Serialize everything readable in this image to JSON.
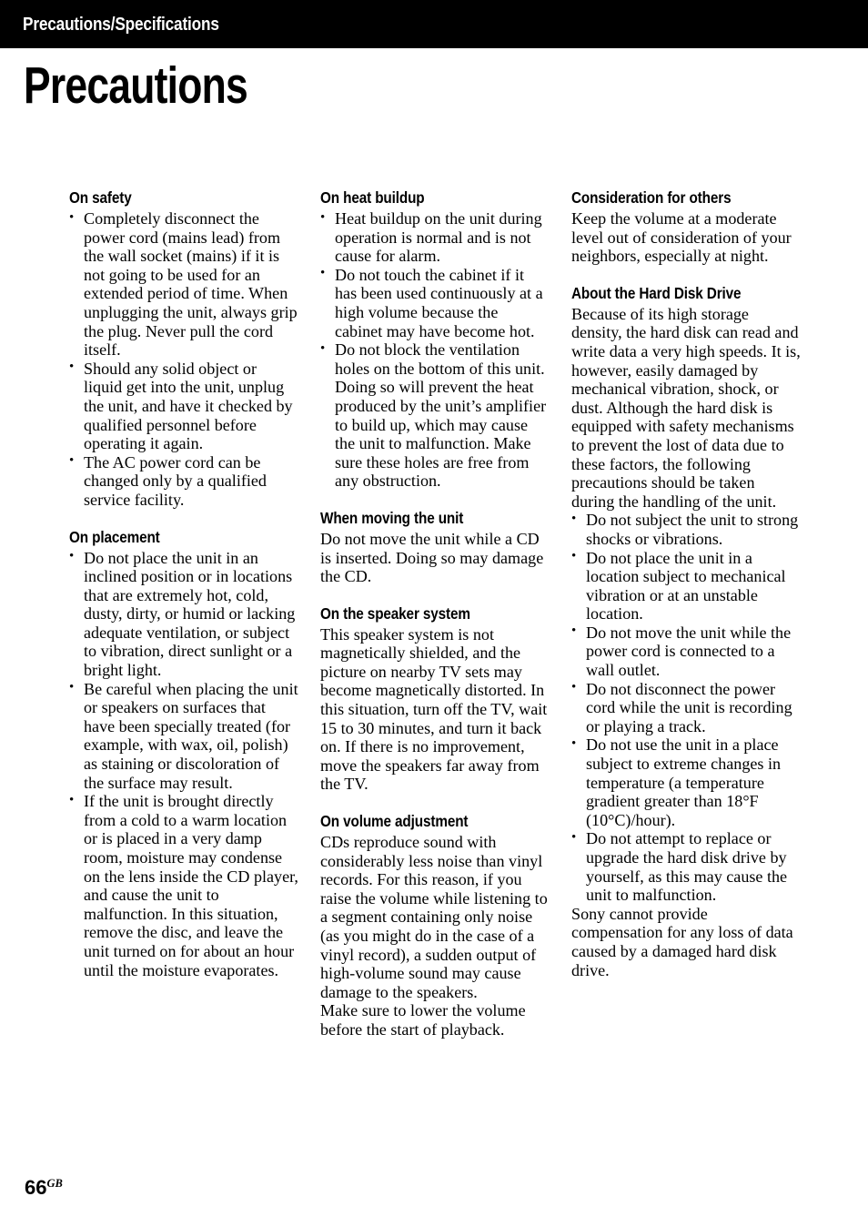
{
  "header": {
    "running_head": "Precautions/Specifications"
  },
  "page_title": "Precautions",
  "footer": {
    "page_number": "66",
    "region_code": "GB"
  },
  "colors": {
    "header_bar_background": "#000000",
    "header_bar_text": "#ffffff",
    "page_background": "#ffffff",
    "body_text": "#000000"
  },
  "columns": [
    {
      "sections": [
        {
          "heading": "On safety",
          "bullets": [
            "Completely disconnect the power cord (mains lead) from the wall socket (mains) if it is not going to be used for an extended period of time. When unplugging the unit, always grip the plug. Never pull the cord itself.",
            "Should any solid object or liquid get into the unit, unplug the unit, and have it checked by qualified personnel before operating it again.",
            "The AC power cord can be changed only by a qualified service facility."
          ],
          "paragraphs": []
        },
        {
          "heading": "On placement",
          "bullets": [
            "Do not place the unit in an inclined position or in locations that are extremely hot, cold, dusty, dirty, or humid or lacking adequate ventilation, or subject to vibration, direct sunlight or a bright light.",
            "Be careful when placing the unit or speakers on surfaces that have been specially treated (for example, with wax, oil, polish) as staining or discoloration of the surface may result.",
            "If the unit is brought directly from a cold to a warm location or is placed in a very damp room, moisture may condense on the lens inside the CD player, and cause the unit to malfunction. In this situation, remove the disc, and leave the unit turned on for about an hour until the moisture evaporates."
          ],
          "paragraphs": []
        }
      ]
    },
    {
      "sections": [
        {
          "heading": "On heat buildup",
          "bullets": [
            "Heat buildup on the unit during operation is normal and is not cause for alarm.",
            "Do not touch the cabinet if it has been used continuously at a high volume because the cabinet may have become hot.",
            "Do not block the ventilation holes on the bottom of this unit. Doing so will prevent the heat produced by the unit’s amplifier to build up, which may cause the unit to malfunction. Make sure these holes are free from any obstruction."
          ],
          "paragraphs": []
        },
        {
          "heading": "When moving the unit",
          "bullets": [],
          "paragraphs": [
            "Do not move the unit while a CD is inserted. Doing so may damage the CD."
          ]
        },
        {
          "heading": "On the speaker system",
          "bullets": [],
          "paragraphs": [
            "This speaker system is not magnetically shielded, and the picture on nearby TV sets may become magnetically distorted. In this situation, turn off the TV, wait 15 to 30 minutes, and turn it back on. If there is no improvement, move the speakers far away from the TV."
          ]
        },
        {
          "heading": "On volume adjustment",
          "bullets": [],
          "paragraphs": [
            "CDs reproduce sound with considerably less noise than vinyl records. For this reason, if you raise the volume while listening to a segment containing only noise (as you might do in the case of a vinyl record), a sudden output of high-volume sound may cause damage to the speakers.",
            "Make sure to lower the volume before the start of playback."
          ]
        }
      ]
    },
    {
      "sections": [
        {
          "heading": "Consideration for others",
          "bullets": [],
          "paragraphs": [
            "Keep the volume at a moderate level out of consideration of your neighbors, especially at night."
          ]
        },
        {
          "heading": "About the Hard Disk Drive",
          "intro": "Because of its high storage density, the hard disk can read and write data a very high speeds. It is, however, easily damaged by mechanical vibration, shock, or dust. Although the hard disk is equipped with safety mechanisms to prevent the lost of data due to these factors, the following precautions should be taken during the handling of the unit.",
          "bullets": [
            "Do not subject the unit to strong shocks or vibrations.",
            "Do not place the unit in a location subject to mechanical vibration or at an unstable location.",
            "Do not move the unit while the power cord is connected to a wall outlet.",
            "Do not disconnect the power cord while the unit is recording or playing a track.",
            "Do not use the unit in a place subject to extreme changes in temperature (a temperature gradient greater than 18°F (10°C)/hour).",
            "Do not attempt to replace or upgrade the hard disk drive by yourself, as this may cause the unit to malfunction."
          ],
          "outro": "Sony cannot provide compensation for any loss of data caused by a damaged hard disk drive."
        }
      ]
    }
  ]
}
